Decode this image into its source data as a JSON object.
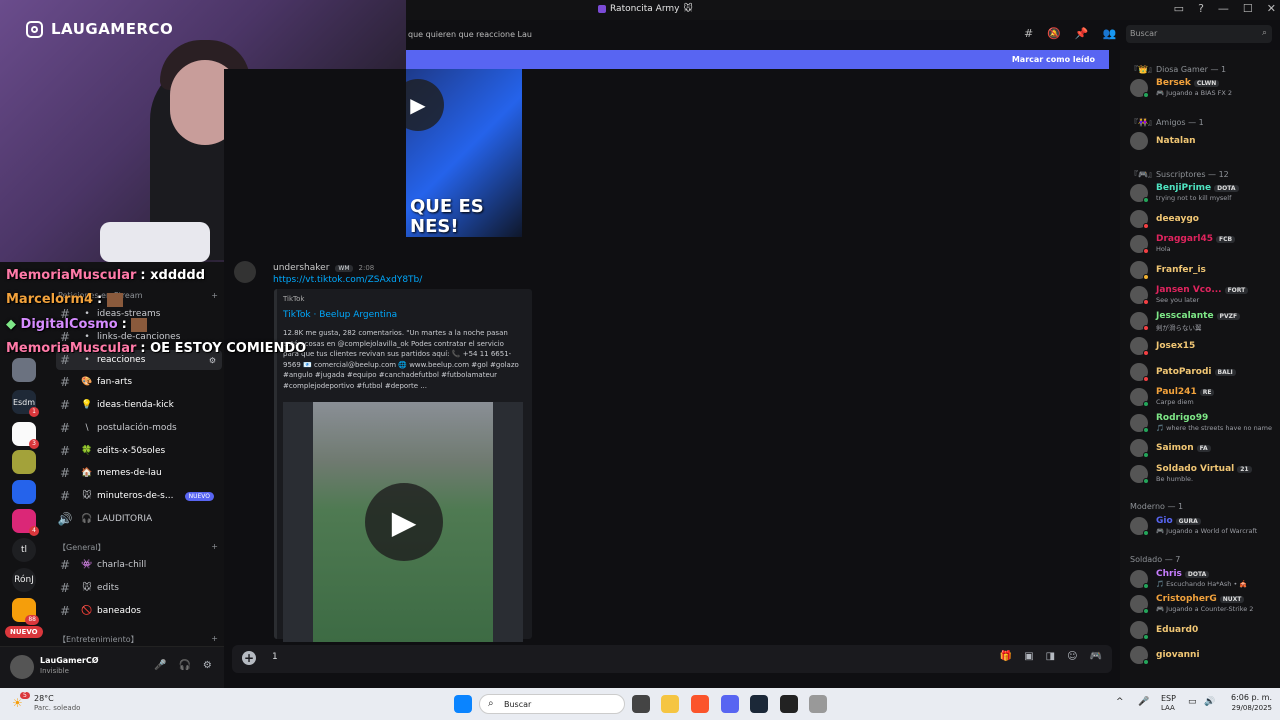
{
  "window": {
    "title": "Ratoncita Army",
    "title_emoji": "🐭"
  },
  "webcam": {
    "brand": "LAUGAMERCO"
  },
  "chat_overlay": [
    {
      "user": "MemoriaMuscular",
      "msg": ": xddddd",
      "color": "#ff7aa8"
    },
    {
      "user": "Marcelorm4",
      "msg": ":",
      "color": "#f2a23c"
    },
    {
      "user": "DigitalCosmo",
      "msg": ":",
      "color": "#d68cff"
    },
    {
      "user": "MemoriaMuscular",
      "msg": ": OE ESTOY COMIENDO",
      "color": "#ff7aa8"
    }
  ],
  "topbar": {
    "topic": "que quieren que reaccione Lau",
    "search_placeholder": "Buscar"
  },
  "banner": {
    "mark_read": "Marcar como leído"
  },
  "servers": [
    {
      "label": "",
      "badge": ""
    },
    {
      "label": "Esdm",
      "badge": "1"
    },
    {
      "label": "",
      "badge": "3"
    },
    {
      "label": "",
      "badge": ""
    },
    {
      "label": "",
      "badge": ""
    },
    {
      "label": "",
      "badge": "4"
    },
    {
      "label": "tl",
      "badge": ""
    },
    {
      "label": "RónJ",
      "badge": ""
    },
    {
      "label": "",
      "badge": "88"
    }
  ],
  "rail_new_badge": "NUEVO",
  "channels": {
    "category_stream": "Peticiones en Stream",
    "items": [
      {
        "name": "ideas-streams",
        "emoji": "",
        "prefix": "#"
      },
      {
        "name": "links-de-canciones",
        "emoji": "",
        "prefix": "#"
      },
      {
        "name": "reacciones",
        "emoji": "",
        "prefix": "#"
      },
      {
        "name": "fan-arts",
        "emoji": "🎨",
        "prefix": "#"
      },
      {
        "name": "ideas-tienda-kick",
        "emoji": "💡",
        "prefix": "#"
      },
      {
        "name": "postulación-mods",
        "emoji": "\\",
        "prefix": "#"
      },
      {
        "name": "edits-x-50soles",
        "emoji": "🍀",
        "prefix": "#"
      },
      {
        "name": "memes-de-lau",
        "emoji": "🏠",
        "prefix": "#"
      },
      {
        "name": "minuteros-de-s...",
        "emoji": "🐭",
        "prefix": "#",
        "badge": "NUEVO"
      },
      {
        "name": "LAUDITORIA",
        "emoji": "🎧",
        "prefix": "🔊"
      }
    ],
    "category_general": "【General】",
    "general_items": [
      {
        "name": "charla-chill",
        "emoji": "👾",
        "prefix": "#"
      },
      {
        "name": "edits",
        "emoji": "🐭",
        "prefix": "#"
      },
      {
        "name": "baneados",
        "emoji": "🚫",
        "prefix": "#"
      }
    ],
    "category_ent": "【Entretenimiento】"
  },
  "user_panel": {
    "name": "LauGamerCØ",
    "status": "Invisible"
  },
  "message": {
    "author": "undershaker",
    "author_tag": "WM",
    "time": "2:08",
    "link": "https://vt.tiktok.com/ZSAxdY8T",
    "link_suffix": "b/",
    "embed_provider": "TikTok",
    "embed_title": "TikTok · Beelup Argentina",
    "embed_desc": "12.8K me gusta, 282 comentarios. \"Un martes a la noche pasan están cosas en @complejolavilla_ok Podes contratar el servicio para que tus clientes revivan sus partidos aquí: 📞 +54 11 6651-9569 📧 comercial@beelup.com 🌐 www.beelup.com #gol #golazo #angulo #jugada #equipo #canchadefutbol #futbolamateur #complejodeportivo #futbol #deporte ...",
    "prev_embed_caption": "QUE ES NES!"
  },
  "composer": {
    "value": "1"
  },
  "members": {
    "groups": [
      {
        "title": "『👑』Diosa Gamer — 1",
        "members": [
          {
            "name": "Bersek",
            "color": "#f2a23c",
            "tag": "CLWN",
            "sub": "🎮 Jugando a BIAS FX 2",
            "status": "#23a55a"
          }
        ]
      },
      {
        "title": "『👭』Amigos — 1",
        "members": [
          {
            "name": "Natalan",
            "color": "#f0c674",
            "tag": "",
            "sub": "",
            "status": ""
          }
        ]
      },
      {
        "title": "『🎮』Suscriptores — 12",
        "members": [
          {
            "name": "BenjiPrime",
            "color": "#4fe3c1",
            "tag": "DOTA",
            "sub": "trying not to kill myself",
            "status": "#23a55a"
          },
          {
            "name": "deeaygo",
            "color": "#f0c674",
            "tag": "",
            "sub": "",
            "status": "#f23f43"
          },
          {
            "name": "Draggarl45",
            "color": "#e0245e",
            "tag": "FCB",
            "sub": "Hola",
            "status": "#f23f43"
          },
          {
            "name": "Franfer_is",
            "color": "#f0c674",
            "tag": "",
            "sub": "",
            "status": "#f0b232"
          },
          {
            "name": "Jansen Vco...",
            "color": "#e0245e",
            "tag": "FORT",
            "sub": "See you later",
            "status": "#f23f43"
          },
          {
            "name": "Jesscalante",
            "color": "#7ee787",
            "tag": "PVZF",
            "sub": "剣が滑らない翼",
            "status": "#f23f43"
          },
          {
            "name": "Josex15",
            "color": "#f0c674",
            "tag": "",
            "sub": "",
            "status": "#f23f43"
          },
          {
            "name": "PatoParodi",
            "color": "#f0c674",
            "tag": "BALI",
            "sub": "",
            "status": "#f23f43"
          },
          {
            "name": "Paul241",
            "color": "#f2a23c",
            "tag": "RE",
            "sub": "Carpe diem",
            "status": "#23a55a"
          },
          {
            "name": "Rodrigo99",
            "color": "#7ee787",
            "tag": "",
            "sub": "🎵 where the streets have no name",
            "status": "#23a55a"
          },
          {
            "name": "Saimon",
            "color": "#f0c674",
            "tag": "FA",
            "sub": "",
            "status": "#23a55a"
          },
          {
            "name": "Soldado Virtual",
            "color": "#f0c674",
            "tag": "21",
            "sub": "Be humble.",
            "status": "#23a55a"
          }
        ]
      },
      {
        "title": "Moderno — 1",
        "members": [
          {
            "name": "Gio",
            "color": "#5865f2",
            "tag": "GURA",
            "sub": "🎮 Jugando a World of Warcraft",
            "status": "#23a55a"
          }
        ]
      },
      {
        "title": "Soldado — 7",
        "members": [
          {
            "name": "Chris",
            "color": "#c77dff",
            "tag": "DOTA",
            "sub": "🎵 Escuchando Ha*Ash • 🎪",
            "status": "#23a55a"
          },
          {
            "name": "CristopherG",
            "color": "#f2a23c",
            "tag": "NUXT",
            "sub": "🎮 Jugando a Counter-Strike 2",
            "status": "#23a55a"
          },
          {
            "name": "Eduard0",
            "color": "#f0c674",
            "tag": "",
            "sub": "",
            "status": "#23a55a"
          },
          {
            "name": "giovanni",
            "color": "#f0c674",
            "tag": "",
            "sub": "",
            "status": "#23a55a"
          }
        ]
      }
    ]
  },
  "taskbar": {
    "weather_temp": "28°C",
    "weather_desc": "Parc. soleado",
    "weather_badge": "5",
    "search_label": "Buscar",
    "lang": "ESP",
    "lang_sub": "LAA",
    "time": "6:06 p. m.",
    "date": "29/08/2025"
  }
}
